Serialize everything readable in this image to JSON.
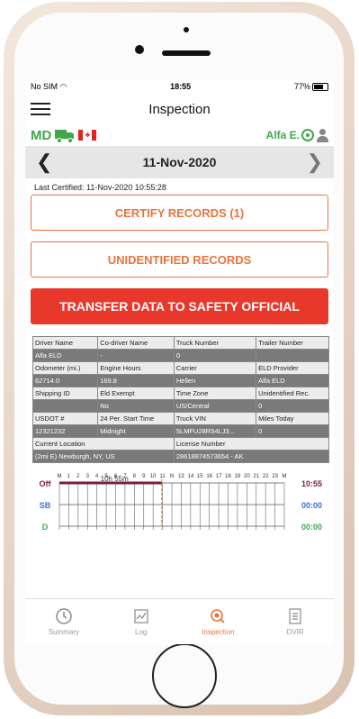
{
  "status": {
    "carrier": "No SIM",
    "time": "18:55",
    "battery": "77%"
  },
  "header": {
    "title": "Inspection"
  },
  "info": {
    "state": "MD",
    "driver": "Alfa E."
  },
  "datebar": {
    "date": "11-Nov-2020"
  },
  "certified": "Last Certified: 11-Nov-2020 10:55:28",
  "buttons": {
    "certify": "CERTIFY RECORDS (1)",
    "unidentified": "UNIDENTIFIED RECORDS",
    "transfer": "TRANSFER DATA TO SAFETY OFFICIAL"
  },
  "table": {
    "rows": [
      [
        "Driver Name",
        "Co-driver Name",
        "Truck Number",
        "Trailer Number"
      ],
      [
        "Alfa ELD",
        "-",
        "0",
        ""
      ],
      [
        "Odometer (mi.)",
        "Engine Hours",
        "Carrier",
        "ELD Provider"
      ],
      [
        "62714.0",
        "169.8",
        "Hellen",
        "Alfa ELD"
      ],
      [
        "Shipping ID",
        "Eld Exempt",
        "Time Zone",
        "Unidentified Rec."
      ],
      [
        "",
        "No",
        "US/Central",
        "0"
      ],
      [
        "USDOT #",
        "24 Per. Start Time",
        "Truck VIN",
        "Miles Today"
      ],
      [
        "12321232",
        "Midnight",
        "5LMFU28R54LJ3...",
        "0"
      ]
    ],
    "location_label": "Current Location",
    "location_value": "(2mi E) Newburgh, NY, US",
    "license_label": "License Number",
    "license_value": "28618874573654 - AK"
  },
  "graph": {
    "hours": [
      "M",
      "1",
      "2",
      "3",
      "4",
      "5",
      "6",
      "7",
      "8",
      "9",
      "10",
      "11",
      "N",
      "13",
      "14",
      "15",
      "16",
      "17",
      "18",
      "19",
      "20",
      "21",
      "22",
      "23",
      "M"
    ],
    "rows": [
      "Off",
      "SB",
      "D"
    ],
    "totals": [
      "10:55",
      "00:00",
      "00:00"
    ],
    "duration_label": "10h 55m",
    "off_duty_hours": 10.92,
    "colors": {
      "off": "#7a1f3a",
      "sb": "#3b6fd6",
      "d": "#3fa84a",
      "current": "#e8a13b"
    }
  },
  "tabs": [
    {
      "label": "Summary",
      "icon": "clock-icon"
    },
    {
      "label": "Log",
      "icon": "chart-line-icon"
    },
    {
      "label": "Inspection",
      "icon": "magnifier-icon"
    },
    {
      "label": "DVIR",
      "icon": "document-icon"
    }
  ]
}
